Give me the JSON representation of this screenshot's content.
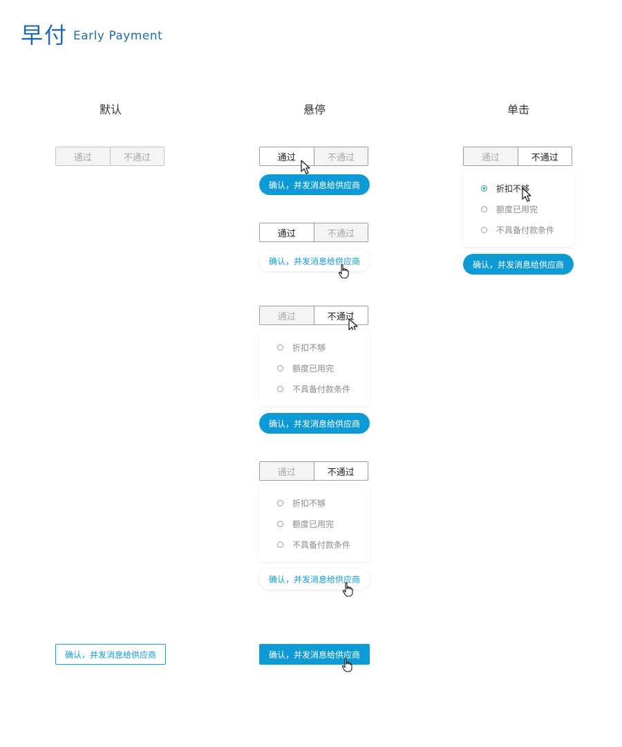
{
  "header": {
    "title_cn": "早付",
    "title_en": "Early Payment"
  },
  "columns": {
    "default": "默认",
    "hover": "悬停",
    "click": "单击"
  },
  "toggle": {
    "pass": "通过",
    "fail": "不通过"
  },
  "confirm_label": "确认，并发消息给供应商",
  "reasons": [
    "折扣不够",
    "额度已用完",
    "不具备付款条件"
  ],
  "icons": {
    "arrow": "arrow-cursor-icon",
    "hand": "hand-cursor-icon",
    "radio": "radio-icon"
  },
  "colors": {
    "accent": "#0e9bd5",
    "title": "#1f6ab0"
  }
}
